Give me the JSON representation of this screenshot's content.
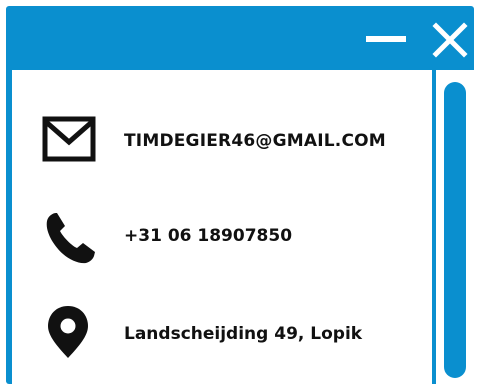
{
  "window": {
    "accent_color": "#0a8fcf",
    "controls": {
      "minimize_icon": "minimize-icon",
      "close_icon": "close-icon"
    }
  },
  "contact": {
    "email": "TIMDEGIER46@GMAIL.COM",
    "phone": "+31 06 18907850",
    "address": "Landscheijding 49, Lopik"
  },
  "icons": {
    "email": "envelope-icon",
    "phone": "phone-icon",
    "address": "location-pin-icon"
  }
}
